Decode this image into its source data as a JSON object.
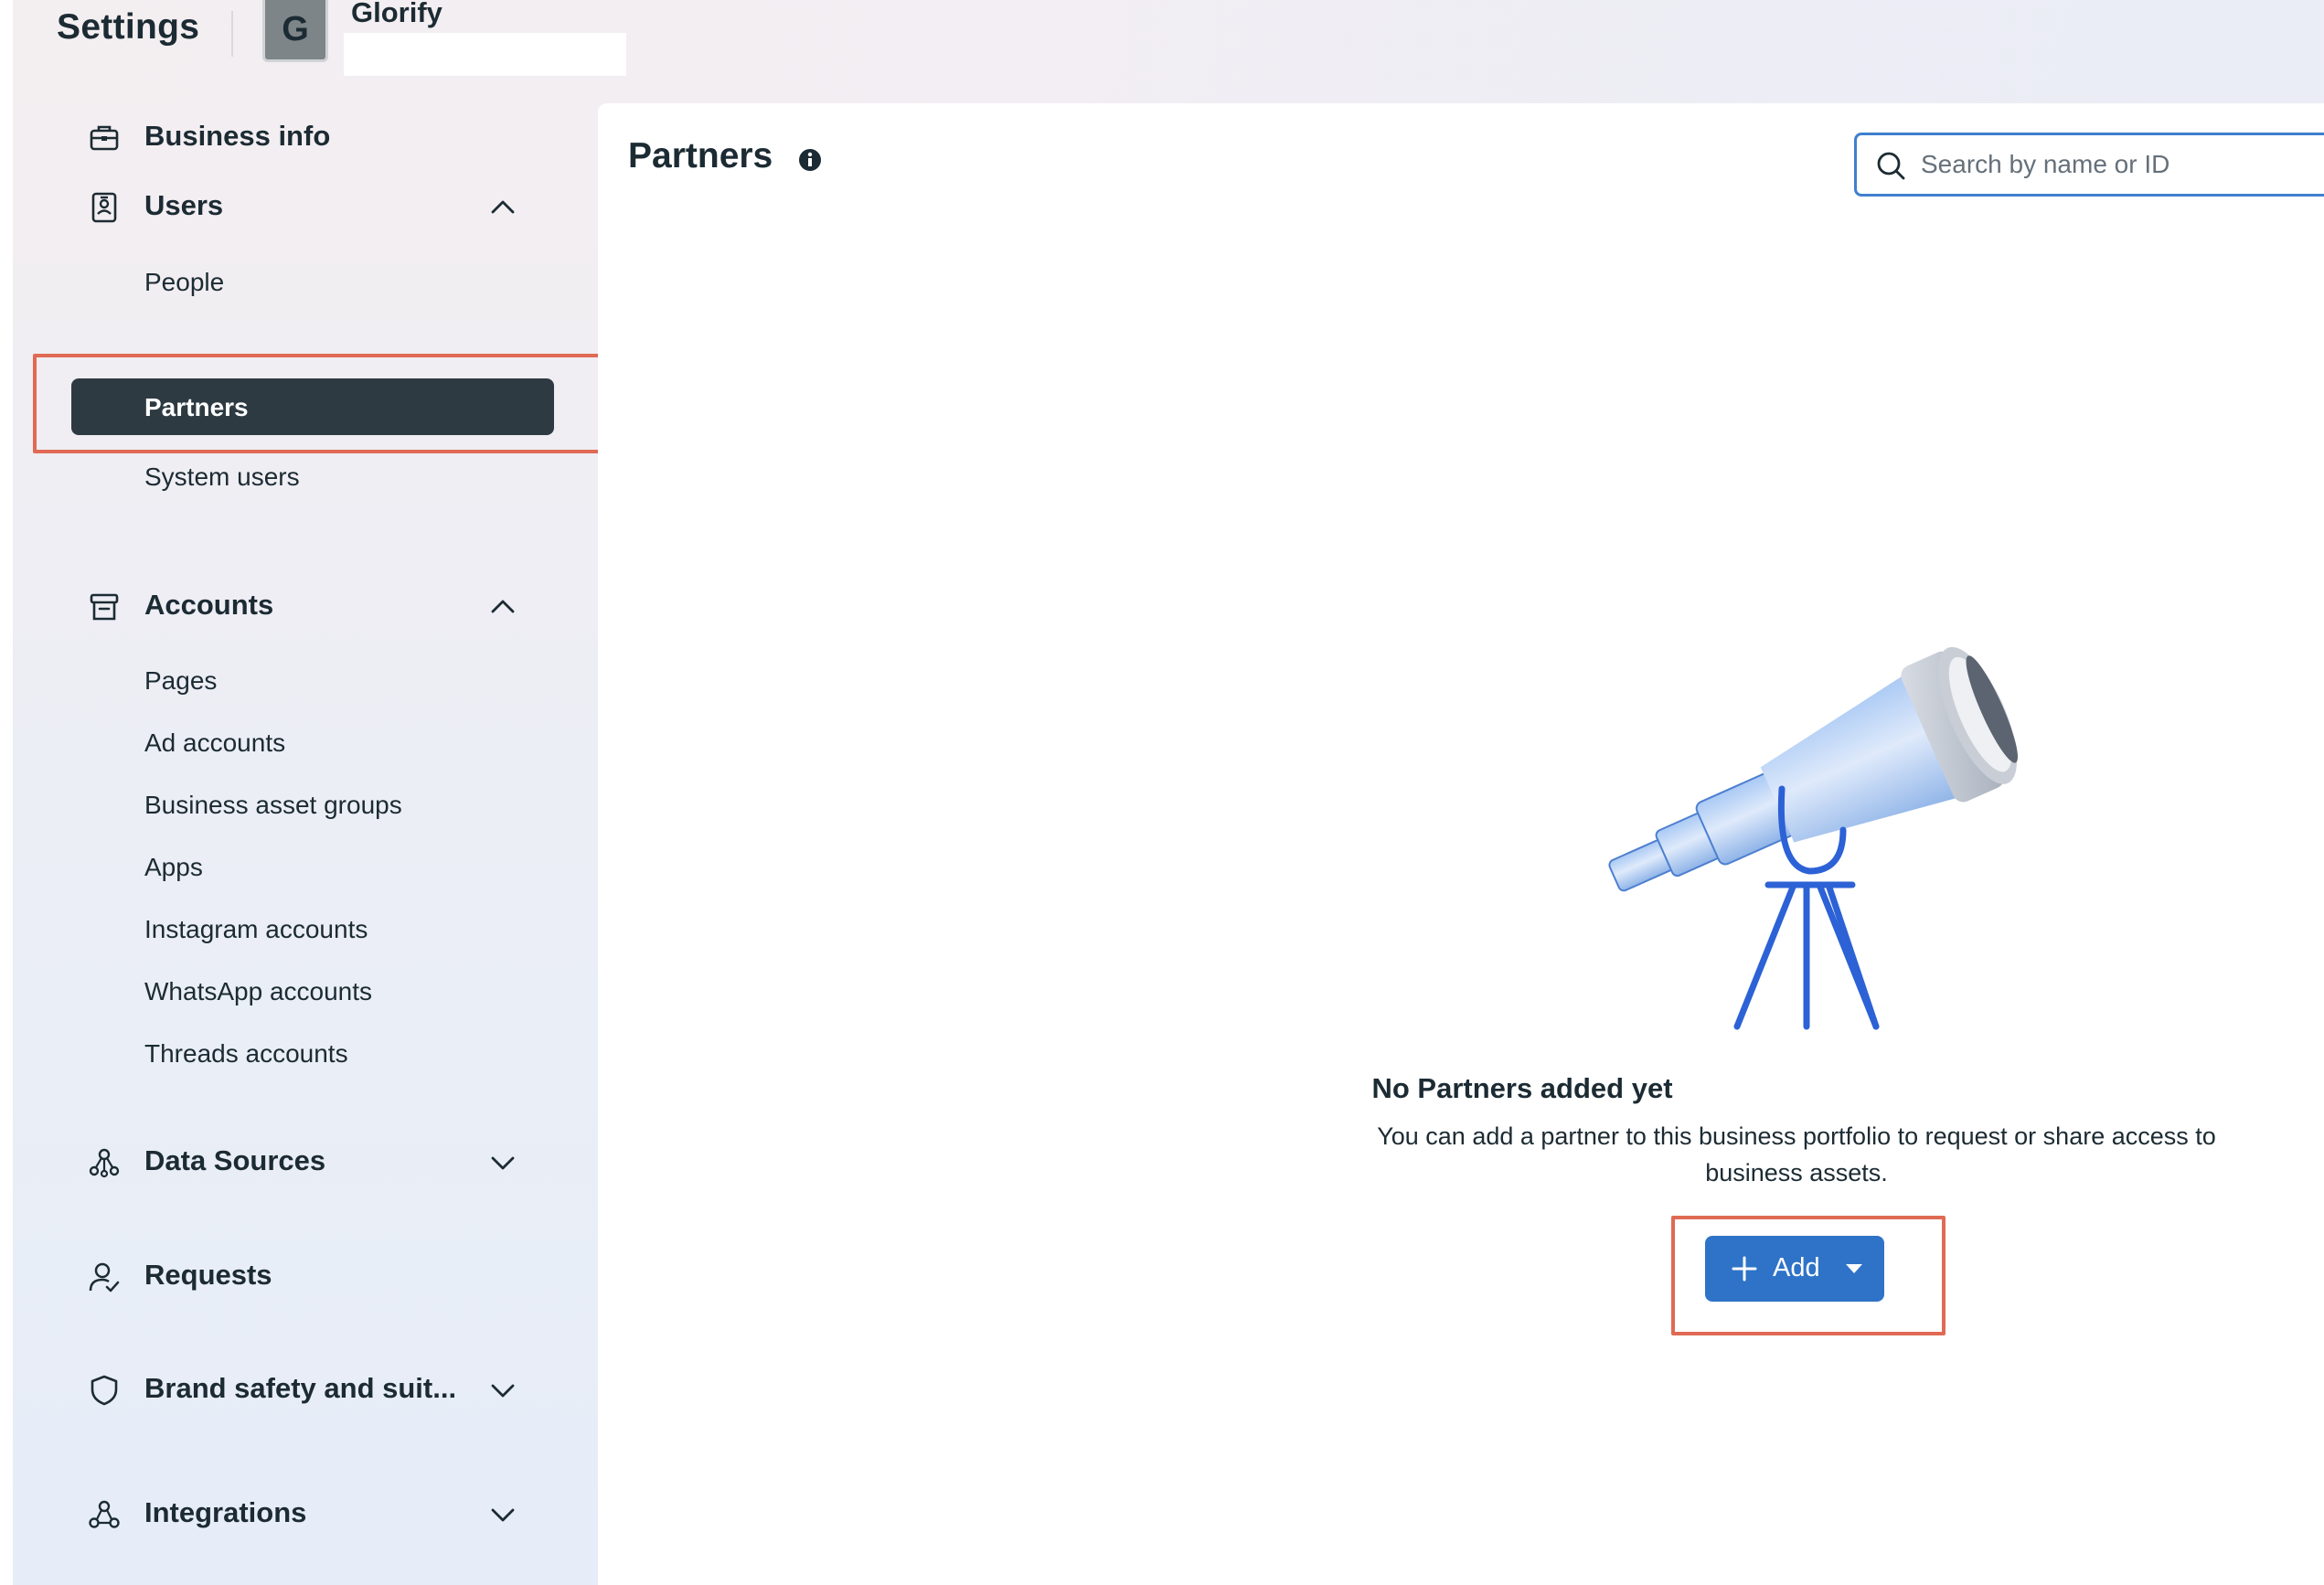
{
  "header": {
    "title": "Settings",
    "portfolio_initial": "G",
    "portfolio_name": "Glorify"
  },
  "sidebar": {
    "sections": [
      {
        "label": "Business info",
        "icon": "briefcase-icon"
      },
      {
        "label": "Users",
        "icon": "id-badge-icon",
        "expanded": true,
        "items": [
          {
            "label": "People"
          },
          {
            "label": "Partners",
            "active": true
          },
          {
            "label": "System users"
          }
        ]
      },
      {
        "label": "Accounts",
        "icon": "archive-box-icon",
        "expanded": true,
        "items": [
          {
            "label": "Pages"
          },
          {
            "label": "Ad accounts"
          },
          {
            "label": "Business asset groups"
          },
          {
            "label": "Apps"
          },
          {
            "label": "Instagram accounts"
          },
          {
            "label": "WhatsApp accounts"
          },
          {
            "label": "Threads accounts"
          }
        ]
      },
      {
        "label": "Data Sources",
        "icon": "data-sources-icon",
        "expanded": false
      },
      {
        "label": "Requests",
        "icon": "person-check-icon"
      },
      {
        "label": "Brand safety and suit...",
        "icon": "shield-icon",
        "expanded": false
      },
      {
        "label": "Integrations",
        "icon": "integrations-icon",
        "expanded": false
      }
    ]
  },
  "main": {
    "title": "Partners",
    "search_placeholder": "Search by name or ID",
    "empty_state": {
      "title": "No Partners added yet",
      "description": "You can add a partner to this business portfolio to request or share access to business assets.",
      "illustration": "telescope"
    },
    "add_button_label": "Add"
  },
  "colors": {
    "accent": "#2e73c7",
    "active_nav": "#2d3a42",
    "highlight": "#e06a54",
    "search_border": "#3f7fcf"
  }
}
